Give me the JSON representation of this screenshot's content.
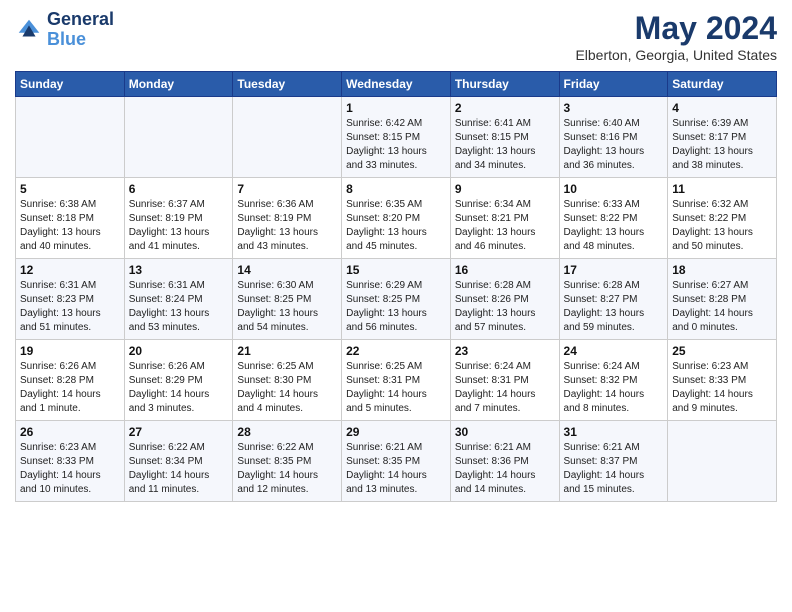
{
  "header": {
    "logo_line1": "General",
    "logo_line2": "Blue",
    "month": "May 2024",
    "location": "Elberton, Georgia, United States"
  },
  "days_of_week": [
    "Sunday",
    "Monday",
    "Tuesday",
    "Wednesday",
    "Thursday",
    "Friday",
    "Saturday"
  ],
  "weeks": [
    [
      {
        "day": "",
        "info": ""
      },
      {
        "day": "",
        "info": ""
      },
      {
        "day": "",
        "info": ""
      },
      {
        "day": "1",
        "info": "Sunrise: 6:42 AM\nSunset: 8:15 PM\nDaylight: 13 hours\nand 33 minutes."
      },
      {
        "day": "2",
        "info": "Sunrise: 6:41 AM\nSunset: 8:15 PM\nDaylight: 13 hours\nand 34 minutes."
      },
      {
        "day": "3",
        "info": "Sunrise: 6:40 AM\nSunset: 8:16 PM\nDaylight: 13 hours\nand 36 minutes."
      },
      {
        "day": "4",
        "info": "Sunrise: 6:39 AM\nSunset: 8:17 PM\nDaylight: 13 hours\nand 38 minutes."
      }
    ],
    [
      {
        "day": "5",
        "info": "Sunrise: 6:38 AM\nSunset: 8:18 PM\nDaylight: 13 hours\nand 40 minutes."
      },
      {
        "day": "6",
        "info": "Sunrise: 6:37 AM\nSunset: 8:19 PM\nDaylight: 13 hours\nand 41 minutes."
      },
      {
        "day": "7",
        "info": "Sunrise: 6:36 AM\nSunset: 8:19 PM\nDaylight: 13 hours\nand 43 minutes."
      },
      {
        "day": "8",
        "info": "Sunrise: 6:35 AM\nSunset: 8:20 PM\nDaylight: 13 hours\nand 45 minutes."
      },
      {
        "day": "9",
        "info": "Sunrise: 6:34 AM\nSunset: 8:21 PM\nDaylight: 13 hours\nand 46 minutes."
      },
      {
        "day": "10",
        "info": "Sunrise: 6:33 AM\nSunset: 8:22 PM\nDaylight: 13 hours\nand 48 minutes."
      },
      {
        "day": "11",
        "info": "Sunrise: 6:32 AM\nSunset: 8:22 PM\nDaylight: 13 hours\nand 50 minutes."
      }
    ],
    [
      {
        "day": "12",
        "info": "Sunrise: 6:31 AM\nSunset: 8:23 PM\nDaylight: 13 hours\nand 51 minutes."
      },
      {
        "day": "13",
        "info": "Sunrise: 6:31 AM\nSunset: 8:24 PM\nDaylight: 13 hours\nand 53 minutes."
      },
      {
        "day": "14",
        "info": "Sunrise: 6:30 AM\nSunset: 8:25 PM\nDaylight: 13 hours\nand 54 minutes."
      },
      {
        "day": "15",
        "info": "Sunrise: 6:29 AM\nSunset: 8:25 PM\nDaylight: 13 hours\nand 56 minutes."
      },
      {
        "day": "16",
        "info": "Sunrise: 6:28 AM\nSunset: 8:26 PM\nDaylight: 13 hours\nand 57 minutes."
      },
      {
        "day": "17",
        "info": "Sunrise: 6:28 AM\nSunset: 8:27 PM\nDaylight: 13 hours\nand 59 minutes."
      },
      {
        "day": "18",
        "info": "Sunrise: 6:27 AM\nSunset: 8:28 PM\nDaylight: 14 hours\nand 0 minutes."
      }
    ],
    [
      {
        "day": "19",
        "info": "Sunrise: 6:26 AM\nSunset: 8:28 PM\nDaylight: 14 hours\nand 1 minute."
      },
      {
        "day": "20",
        "info": "Sunrise: 6:26 AM\nSunset: 8:29 PM\nDaylight: 14 hours\nand 3 minutes."
      },
      {
        "day": "21",
        "info": "Sunrise: 6:25 AM\nSunset: 8:30 PM\nDaylight: 14 hours\nand 4 minutes."
      },
      {
        "day": "22",
        "info": "Sunrise: 6:25 AM\nSunset: 8:31 PM\nDaylight: 14 hours\nand 5 minutes."
      },
      {
        "day": "23",
        "info": "Sunrise: 6:24 AM\nSunset: 8:31 PM\nDaylight: 14 hours\nand 7 minutes."
      },
      {
        "day": "24",
        "info": "Sunrise: 6:24 AM\nSunset: 8:32 PM\nDaylight: 14 hours\nand 8 minutes."
      },
      {
        "day": "25",
        "info": "Sunrise: 6:23 AM\nSunset: 8:33 PM\nDaylight: 14 hours\nand 9 minutes."
      }
    ],
    [
      {
        "day": "26",
        "info": "Sunrise: 6:23 AM\nSunset: 8:33 PM\nDaylight: 14 hours\nand 10 minutes."
      },
      {
        "day": "27",
        "info": "Sunrise: 6:22 AM\nSunset: 8:34 PM\nDaylight: 14 hours\nand 11 minutes."
      },
      {
        "day": "28",
        "info": "Sunrise: 6:22 AM\nSunset: 8:35 PM\nDaylight: 14 hours\nand 12 minutes."
      },
      {
        "day": "29",
        "info": "Sunrise: 6:21 AM\nSunset: 8:35 PM\nDaylight: 14 hours\nand 13 minutes."
      },
      {
        "day": "30",
        "info": "Sunrise: 6:21 AM\nSunset: 8:36 PM\nDaylight: 14 hours\nand 14 minutes."
      },
      {
        "day": "31",
        "info": "Sunrise: 6:21 AM\nSunset: 8:37 PM\nDaylight: 14 hours\nand 15 minutes."
      },
      {
        "day": "",
        "info": ""
      }
    ]
  ]
}
